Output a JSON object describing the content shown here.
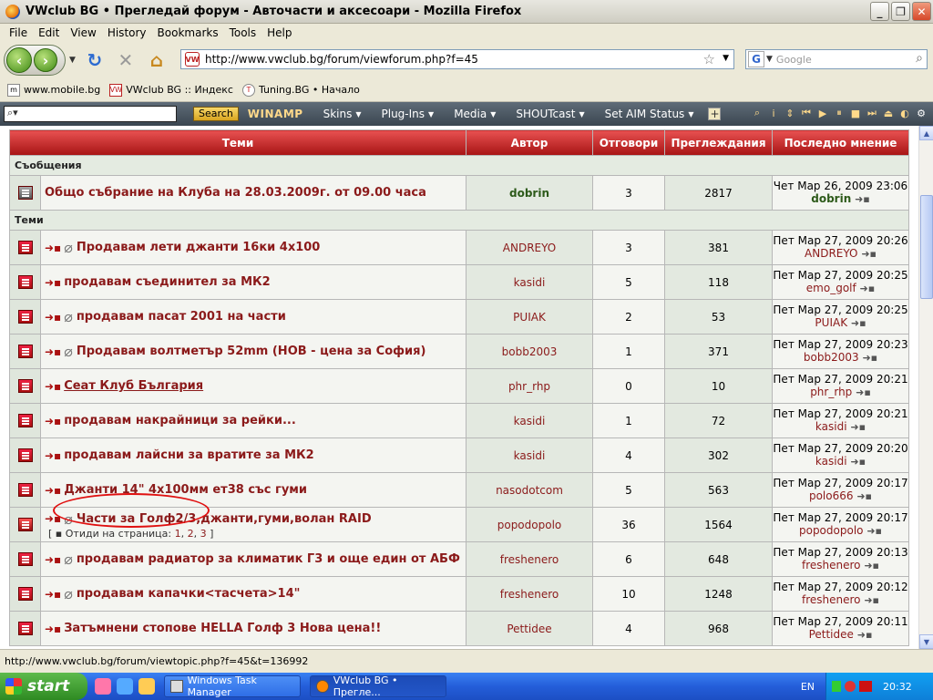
{
  "window": {
    "title": "VWclub BG • Прегледай форум - Авточасти и аксесоари - Mozilla Firefox",
    "min": "_",
    "max": "❐",
    "close": "✕"
  },
  "menu": [
    "File",
    "Edit",
    "View",
    "History",
    "Bookmarks",
    "Tools",
    "Help"
  ],
  "nav": {
    "url": "http://www.vwclub.bg/forum/viewforum.php?f=45",
    "search_placeholder": "Google",
    "google_letter": "G",
    "fav_text": "VW"
  },
  "bookmarks": [
    {
      "label": "www.mobile.bg",
      "icon": "m"
    },
    {
      "label": "VWclub BG :: Индекс",
      "icon": "VW"
    },
    {
      "label": "Tuning.BG • Начало",
      "icon": "T"
    }
  ],
  "winamp": {
    "search_btn": "Search",
    "logo": "WINAMP",
    "menus": [
      "Skins",
      "Plug-Ins",
      "Media",
      "SHOUTcast",
      "Set AIM Status"
    ]
  },
  "table": {
    "headers": [
      "Теми",
      "Автор",
      "Отговори",
      "Преглеждания",
      "Последно мнение"
    ],
    "section_announce": "Съобщения",
    "section_topics": "Теми",
    "announce": {
      "title": "Общо събрание на Клуба на 28.03.2009г. от 09.00 часа",
      "author": "dobrin",
      "replies": "3",
      "views": "2817",
      "last_date": "Чет Мар 26, 2009 23:06",
      "last_by": "dobrin"
    },
    "rows": [
      {
        "title": "Продавам лети джанти 16ки 4x100",
        "author": "ANDREYO",
        "replies": "3",
        "views": "381",
        "last_date": "Пет Мар 27, 2009 20:26",
        "last_by": "ANDREYO",
        "clip": true
      },
      {
        "title": "продавам съединител за МК2",
        "author": "kasidi",
        "replies": "5",
        "views": "118",
        "last_date": "Пет Мар 27, 2009 20:25",
        "last_by": "emo_golf",
        "clip": false
      },
      {
        "title": "продавам пасат 2001 на части",
        "author": "PUIAK",
        "replies": "2",
        "views": "53",
        "last_date": "Пет Мар 27, 2009 20:25",
        "last_by": "PUIAK",
        "clip": true
      },
      {
        "title": "Продавам волтметър 52mm (НОВ - цена за София)",
        "author": "bobb2003",
        "replies": "1",
        "views": "371",
        "last_date": "Пет Мар 27, 2009 20:23",
        "last_by": "bobb2003",
        "clip": true
      },
      {
        "title": "Сеат Клуб България",
        "author": "phr_rhp",
        "replies": "0",
        "views": "10",
        "last_date": "Пет Мар 27, 2009 20:21",
        "last_by": "phr_rhp",
        "clip": false
      },
      {
        "title": "продавам накрайници за рейки...",
        "author": "kasidi",
        "replies": "1",
        "views": "72",
        "last_date": "Пет Мар 27, 2009 20:21",
        "last_by": "kasidi",
        "clip": false
      },
      {
        "title": "продавам лайсни за вратите за МК2",
        "author": "kasidi",
        "replies": "4",
        "views": "302",
        "last_date": "Пет Мар 27, 2009 20:20",
        "last_by": "kasidi",
        "clip": false
      },
      {
        "title": "Джанти 14\" 4x100мм ет38 със гуми",
        "author": "nasodotcom",
        "replies": "5",
        "views": "563",
        "last_date": "Пет Мар 27, 2009 20:17",
        "last_by": "polo666",
        "clip": false
      },
      {
        "title": "Части за Голф2/3,джанти,гуми,волан RAID",
        "author": "popodopolo",
        "replies": "36",
        "views": "1564",
        "last_date": "Пет Мар 27, 2009 20:17",
        "last_by": "popodopolo",
        "clip": true
      },
      {
        "title": "продавам радиатор за климатик Г3 и още един от АБФ",
        "author": "freshenero",
        "replies": "6",
        "views": "648",
        "last_date": "Пет Мар 27, 2009 20:13",
        "last_by": "freshenero",
        "clip": true
      },
      {
        "title": "продавам капачки<тасчета>14\"",
        "author": "freshenero",
        "replies": "10",
        "views": "1248",
        "last_date": "Пет Мар 27, 2009 20:12",
        "last_by": "freshenero",
        "clip": true
      },
      {
        "title": "Затъмнени стопове HELLA Голф 3 Нова цена!!",
        "author": "Pettidee",
        "replies": "4",
        "views": "968",
        "last_date": "Пет Мар 27, 2009 20:11",
        "last_by": "Pettidee",
        "clip": false
      }
    ],
    "pages": {
      "open": "[",
      "label": "Отиди на страница:",
      "p1": "1",
      "p2": "2",
      "p3": "3",
      "close": "]"
    }
  },
  "status": "http://www.vwclub.bg/forum/viewtopic.php?f=45&t=136992",
  "taskbar": {
    "start": "start",
    "tasks": [
      "Windows Task Manager",
      "VWclub BG • Прегле..."
    ],
    "lang": "EN",
    "time": "20:32"
  }
}
